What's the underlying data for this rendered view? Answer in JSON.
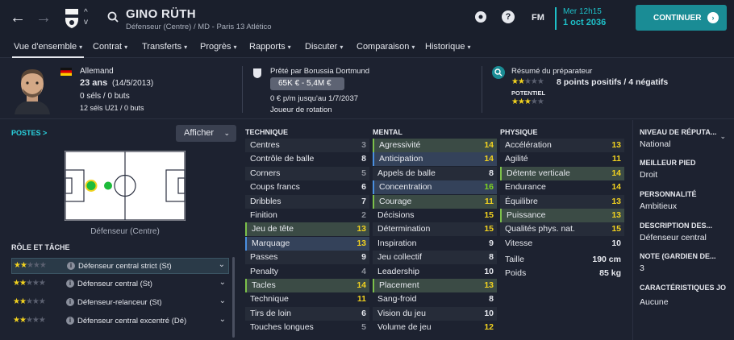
{
  "header": {
    "player_name": "GINO RÜTH",
    "subtitle": "Défenseur (Centre) / MD - Paris 13 Atlético",
    "fm_label": "FM",
    "date_line1": "Mer 12h15",
    "date_line2": "1 oct 2036",
    "continue_label": "CONTINUER"
  },
  "tabs": [
    {
      "label": "Vue d'ensemble"
    },
    {
      "label": "Contrat"
    },
    {
      "label": "Transferts"
    },
    {
      "label": "Progrès"
    },
    {
      "label": "Rapports"
    },
    {
      "label": "Discuter"
    },
    {
      "label": "Comparaison"
    },
    {
      "label": "Historique"
    }
  ],
  "info": {
    "nationality": "Allemand",
    "age": "23 ans",
    "birth": "(14/5/2013)",
    "caps": "0 séls / 0 buts",
    "u21_caps": "12 séls U21 / 0 buts",
    "loan_label": "Prêté par Borussia Dortmund",
    "value_range": "65K € - 5,4M €",
    "wage": "0 € p/m jusqu'au 1/7/2037",
    "squad_status": "Joueur de rotation",
    "scout_title": "Résumé du préparateur",
    "scout_summary": "8 points positifs / 4 négatifs",
    "potential_label": "POTENTIEL",
    "current_stars": 2,
    "potential_stars": 3
  },
  "positions": {
    "title": "POSTES >",
    "show_button": "Afficher",
    "position_label": "Défenseur (Centre)"
  },
  "roles": {
    "title": "RÔLE ET TÂCHE",
    "items": [
      {
        "name": "Défenseur central strict (St)",
        "stars": 2
      },
      {
        "name": "Défenseur central (St)",
        "stars": 2
      },
      {
        "name": "Défenseur-relanceur (St)",
        "stars": 2
      },
      {
        "name": "Défenseur central excentré (Dé)",
        "stars": 2
      }
    ]
  },
  "technique": {
    "title": "TECHNIQUE",
    "rows": [
      {
        "name": "Centres",
        "value": "3",
        "hl": ""
      },
      {
        "name": "Contrôle de balle",
        "value": "8",
        "hl": ""
      },
      {
        "name": "Corners",
        "value": "5",
        "hl": ""
      },
      {
        "name": "Coups francs",
        "value": "6",
        "hl": ""
      },
      {
        "name": "Dribbles",
        "value": "7",
        "hl": ""
      },
      {
        "name": "Finition",
        "value": "2",
        "hl": ""
      },
      {
        "name": "Jeu de tête",
        "value": "13",
        "hl": "g"
      },
      {
        "name": "Marquage",
        "value": "13",
        "hl": "b"
      },
      {
        "name": "Passes",
        "value": "9",
        "hl": ""
      },
      {
        "name": "Penalty",
        "value": "4",
        "hl": ""
      },
      {
        "name": "Tacles",
        "value": "14",
        "hl": "g"
      },
      {
        "name": "Technique",
        "value": "11",
        "hl": ""
      },
      {
        "name": "Tirs de loin",
        "value": "6",
        "hl": ""
      },
      {
        "name": "Touches longues",
        "value": "5",
        "hl": ""
      }
    ]
  },
  "mental": {
    "title": "MENTAL",
    "rows": [
      {
        "name": "Agressivité",
        "value": "14",
        "hl": "g"
      },
      {
        "name": "Anticipation",
        "value": "14",
        "hl": "b"
      },
      {
        "name": "Appels de balle",
        "value": "8",
        "hl": ""
      },
      {
        "name": "Concentration",
        "value": "16",
        "hl": "b"
      },
      {
        "name": "Courage",
        "value": "11",
        "hl": "g"
      },
      {
        "name": "Décisions",
        "value": "15",
        "hl": ""
      },
      {
        "name": "Détermination",
        "value": "15",
        "hl": ""
      },
      {
        "name": "Inspiration",
        "value": "9",
        "hl": ""
      },
      {
        "name": "Jeu collectif",
        "value": "8",
        "hl": ""
      },
      {
        "name": "Leadership",
        "value": "10",
        "hl": ""
      },
      {
        "name": "Placement",
        "value": "13",
        "hl": "g"
      },
      {
        "name": "Sang-froid",
        "value": "8",
        "hl": ""
      },
      {
        "name": "Vision du jeu",
        "value": "10",
        "hl": ""
      },
      {
        "name": "Volume de jeu",
        "value": "12",
        "hl": ""
      }
    ]
  },
  "physique": {
    "title": "PHYSIQUE",
    "rows": [
      {
        "name": "Accélération",
        "value": "13",
        "hl": ""
      },
      {
        "name": "Agilité",
        "value": "11",
        "hl": ""
      },
      {
        "name": "Détente verticale",
        "value": "14",
        "hl": "g"
      },
      {
        "name": "Endurance",
        "value": "14",
        "hl": ""
      },
      {
        "name": "Équilibre",
        "value": "13",
        "hl": ""
      },
      {
        "name": "Puissance",
        "value": "13",
        "hl": "g"
      },
      {
        "name": "Qualités phys. nat.",
        "value": "15",
        "hl": ""
      },
      {
        "name": "Vitesse",
        "value": "10",
        "hl": ""
      }
    ],
    "height_label": "Taille",
    "height_value": "190 cm",
    "weight_label": "Poids",
    "weight_value": "85 kg"
  },
  "right_panel": {
    "reputation_title": "NIVEAU DE RÉPUTA...",
    "reputation_value": "National",
    "foot_title": "MEILLEUR PIED",
    "foot_value": "Droit",
    "personality_title": "PERSONNALITÉ",
    "personality_value": "Ambitieux",
    "description_title": "DESCRIPTION DES...",
    "description_value": "Défenseur central",
    "gk_note_title": "NOTE (GARDIEN DE...",
    "gk_note_value": "3",
    "traits_title": "CARACTÉRISTIQUES JO",
    "traits_value": "Aucune"
  },
  "colors": {
    "accent": "#1a8c95",
    "date": "#1ec0c8",
    "value_high": "#7ed321",
    "value_good": "#f2d21f"
  }
}
